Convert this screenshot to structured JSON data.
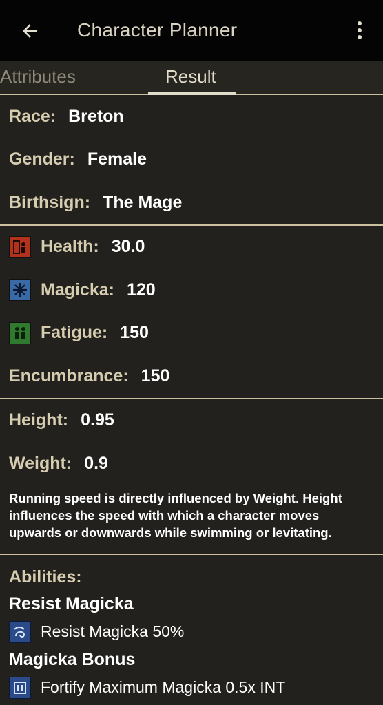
{
  "appbar": {
    "title": "Character Planner",
    "back_icon": "arrow-back-icon",
    "menu_icon": "more-vert-icon"
  },
  "tabs": [
    {
      "label": "Attributes",
      "selected": false
    },
    {
      "label": "Result",
      "selected": true
    }
  ],
  "basic": {
    "race_label": "Race:",
    "race": "Breton",
    "gender_label": "Gender:",
    "gender": "Female",
    "birthsign_label": "Birthsign:",
    "birthsign": "The Mage"
  },
  "stats": {
    "health_label": "Health:",
    "health": "30.0",
    "magicka_label": "Magicka:",
    "magicka": "120",
    "fatigue_label": "Fatigue:",
    "fatigue": "150",
    "encumbrance_label": "Encumbrance:",
    "encumbrance": "150"
  },
  "body": {
    "height_label": "Height:",
    "height": "0.95",
    "weight_label": "Weight:",
    "weight": "0.9",
    "description": "Running speed is directly influenced by Weight. Height influences the speed with which a character moves upwards or downwards while swimming or levitating."
  },
  "abilities": {
    "title": "Abilities:",
    "items": [
      {
        "name": "Resist Magicka",
        "effect": "Resist Magicka 50%"
      },
      {
        "name": "Magicka Bonus",
        "effect": "Fortify Maximum Magicka 0.5x INT"
      }
    ]
  },
  "colors": {
    "background": "#22211d",
    "appbar": "#040404",
    "accent": "#cbbf9e",
    "label": "#d6ccb0"
  }
}
